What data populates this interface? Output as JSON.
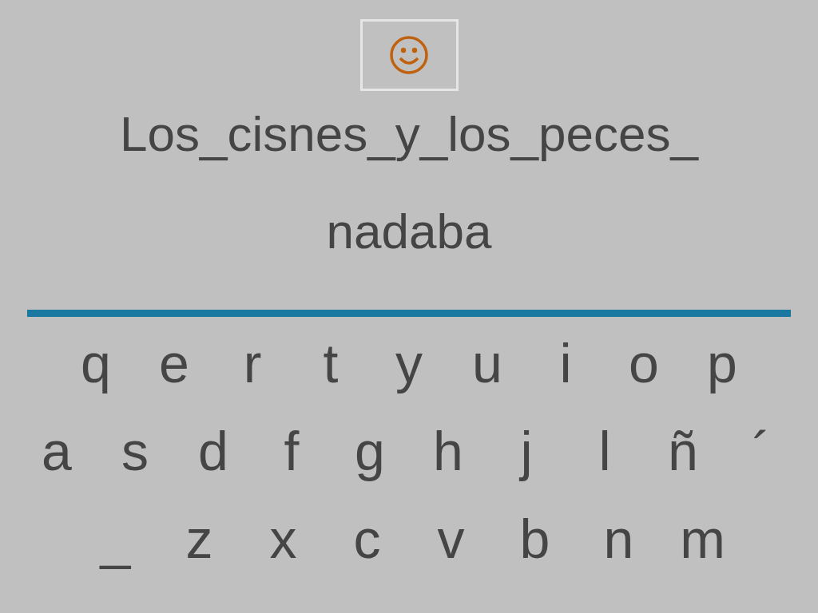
{
  "phrase": "Los_cisnes_y_los_peces_",
  "answer": "nadaba",
  "keyboard": [
    [
      "q",
      "e",
      "r",
      "t",
      "y",
      "u",
      "i",
      "o",
      "p"
    ],
    [
      "a",
      "s",
      "d",
      "f",
      "g",
      "h",
      "j",
      "l",
      "ñ",
      "´"
    ],
    [
      "_",
      "z",
      "x",
      "c",
      "v",
      "b",
      "n",
      "m"
    ]
  ]
}
